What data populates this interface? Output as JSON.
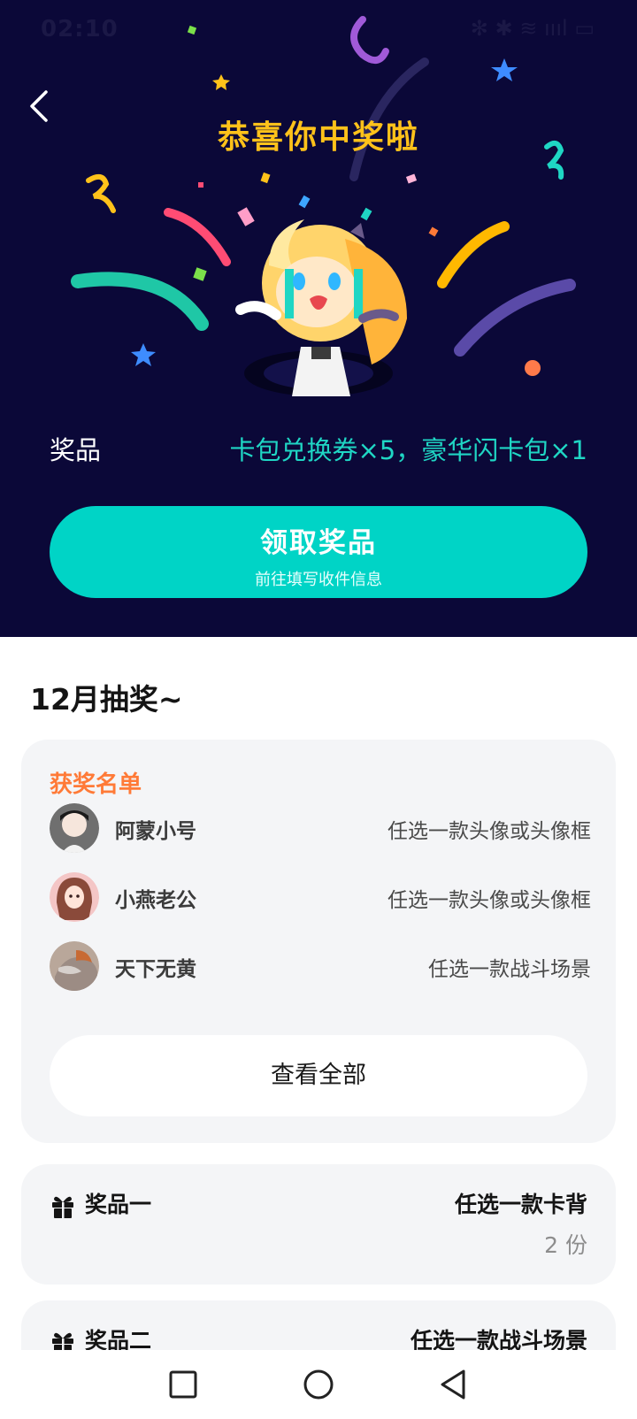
{
  "status_bar": {
    "time": "02:10",
    "icons": "✻ ✱ ≋ ıııl ▭"
  },
  "header": {
    "title": "恭喜你中奖啦"
  },
  "prize": {
    "label": "奖品",
    "value": "卡包兑换券×5，豪华闪卡包×1"
  },
  "claim": {
    "title": "领取奖品",
    "subtitle": "前往填写收件信息"
  },
  "section_title": "12月抽奖~",
  "winners": {
    "title": "获奖名单",
    "items": [
      {
        "name": "阿蒙小号",
        "prize": "任选一款头像或头像框",
        "avatar_color": "#6f6f6f"
      },
      {
        "name": "小燕老公",
        "prize": "任选一款头像或头像框",
        "avatar_color": "#f4c6c6"
      },
      {
        "name": "天下无黄",
        "prize": "任选一款战斗场景",
        "avatar_color": "#b9a79a"
      }
    ],
    "view_all": "查看全部"
  },
  "prizes": [
    {
      "label": "奖品一",
      "name": "任选一款卡背",
      "count": "2 份"
    },
    {
      "label": "奖品二",
      "name": "任选一款战斗场景"
    }
  ],
  "colors": {
    "hero_bg": "#0b0838",
    "title_yellow": "#ffc21a",
    "teal": "#00d4c6",
    "winner_title": "#ff7a37"
  },
  "icons": [
    "back-arrow-icon",
    "gift-icon",
    "nav-square-icon",
    "nav-circle-icon",
    "nav-triangle-icon"
  ]
}
